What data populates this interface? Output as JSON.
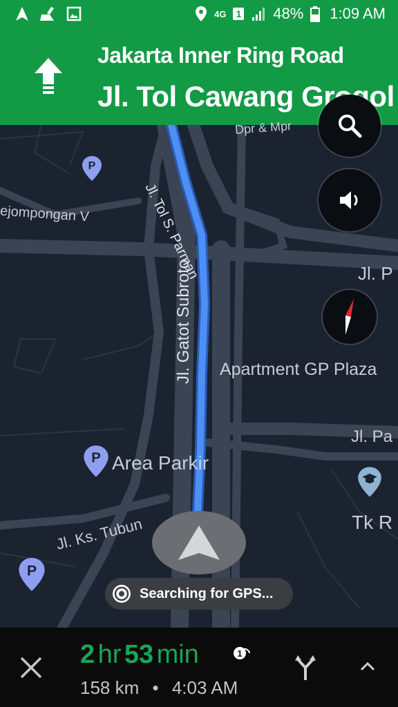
{
  "status_bar": {
    "network": "4G",
    "sim": "1",
    "battery": "48%",
    "time": "1:09 AM",
    "icons": [
      "navigation-icon",
      "cleaner-icon",
      "image-icon",
      "location-icon",
      "network-4g-icon",
      "sim-icon",
      "signal-icon",
      "battery-icon"
    ]
  },
  "nav": {
    "maneuver_icon": "arrow-up-icon",
    "road_small": "Jakarta Inner Ring Road",
    "road_big": "Jl. Tol Cawang Grogol"
  },
  "map": {
    "labels": {
      "dpr": "Dpr & Mpr",
      "pejompongan": "ejompongan V",
      "tol_parman": "Jl. Tol S. Parman",
      "gatot": "Jl. Gatot Subroto",
      "jlp_top": "Jl. P",
      "apartment": "Apartment GP Plaza",
      "jlpa": "Jl. Pa",
      "area_parkir": "Area Parkir",
      "tubun": "Jl. Ks. Tubun",
      "tkr": "Tk R",
      "pin_letter": "P"
    },
    "colors": {
      "background": "#1b2330",
      "road": "#3b4454",
      "route": "#4d8ff5",
      "header_green": "#139a45",
      "eta_green": "#19a555"
    }
  },
  "controls": {
    "search": "search-icon",
    "sound": "volume-icon",
    "compass": "compass-icon",
    "recenter": "navigation-arrow-icon",
    "gps_status": "Searching for GPS..."
  },
  "trip": {
    "hours": "2",
    "hours_unit": "hr",
    "minutes": "53",
    "minutes_unit": "min",
    "distance": "158 km",
    "separator": "•",
    "arrival": "4:03 AM"
  },
  "bottom_icons": [
    "close-icon",
    "alternate-routes-icon",
    "chevron-up-icon",
    "traffic-badge-icon"
  ]
}
